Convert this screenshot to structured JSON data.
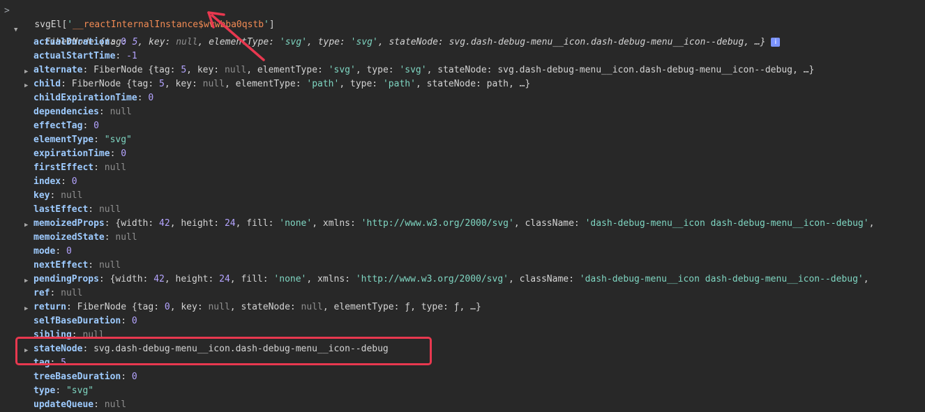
{
  "command": {
    "prompt": ">",
    "prefix": "svgEl[",
    "quote_open": "'",
    "prop_name": "__reactInternalInstance$wvwbba0qstb",
    "quote_close": "'",
    "suffix": "]"
  },
  "root": {
    "label": "FiberNode",
    "summary_1": " {tag: ",
    "tag": "5",
    "summary_2": ", key: ",
    "key": "null",
    "summary_3": ", elementType: ",
    "elementType": "'svg'",
    "summary_4": ", type: ",
    "type": "'svg'",
    "summary_5": ", stateNode: ",
    "stateNode": "svg.dash-debug-menu__icon.dash-debug-menu__icon--debug",
    "summary_6": ", …}"
  },
  "props": [
    {
      "key": "actualDuration",
      "sep": ": ",
      "value": "0",
      "kind": "num",
      "expandable": false
    },
    {
      "key": "actualStartTime",
      "sep": ": ",
      "value": "-1",
      "kind": "num",
      "expandable": false
    },
    {
      "key": "alternate",
      "sep": ": ",
      "value": "FiberNode {tag: 5, key: null, elementType: 'svg', type: 'svg', stateNode: svg.dash-debug-menu__icon.dash-debug-menu__icon--debug, …}",
      "kind": "obj",
      "expandable": true
    },
    {
      "key": "child",
      "sep": ": ",
      "value": "FiberNode {tag: 5, key: null, elementType: 'path', type: 'path', stateNode: path, …}",
      "kind": "obj",
      "expandable": true
    },
    {
      "key": "childExpirationTime",
      "sep": ": ",
      "value": "0",
      "kind": "num",
      "expandable": false
    },
    {
      "key": "dependencies",
      "sep": ": ",
      "value": "null",
      "kind": "nul",
      "expandable": false
    },
    {
      "key": "effectTag",
      "sep": ": ",
      "value": "0",
      "kind": "num",
      "expandable": false
    },
    {
      "key": "elementType",
      "sep": ": ",
      "value": "\"svg\"",
      "kind": "str",
      "expandable": false
    },
    {
      "key": "expirationTime",
      "sep": ": ",
      "value": "0",
      "kind": "num",
      "expandable": false
    },
    {
      "key": "firstEffect",
      "sep": ": ",
      "value": "null",
      "kind": "nul",
      "expandable": false
    },
    {
      "key": "index",
      "sep": ": ",
      "value": "0",
      "kind": "num",
      "expandable": false
    },
    {
      "key": "key",
      "sep": ": ",
      "value": "null",
      "kind": "nul",
      "expandable": false
    },
    {
      "key": "lastEffect",
      "sep": ": ",
      "value": "null",
      "kind": "nul",
      "expandable": false
    },
    {
      "key": "memoizedProps",
      "sep": ": ",
      "value": "{width: 42, height: 24, fill: 'none', xmlns: 'http://www.w3.org/2000/svg', className: 'dash-debug-menu__icon dash-debug-menu__icon--debug',",
      "kind": "obj",
      "expandable": true
    },
    {
      "key": "memoizedState",
      "sep": ": ",
      "value": "null",
      "kind": "nul",
      "expandable": false
    },
    {
      "key": "mode",
      "sep": ": ",
      "value": "0",
      "kind": "num",
      "expandable": false
    },
    {
      "key": "nextEffect",
      "sep": ": ",
      "value": "null",
      "kind": "nul",
      "expandable": false
    },
    {
      "key": "pendingProps",
      "sep": ": ",
      "value": "{width: 42, height: 24, fill: 'none', xmlns: 'http://www.w3.org/2000/svg', className: 'dash-debug-menu__icon dash-debug-menu__icon--debug',",
      "kind": "obj",
      "expandable": true
    },
    {
      "key": "ref",
      "sep": ": ",
      "value": "null",
      "kind": "nul",
      "expandable": false
    },
    {
      "key": "return",
      "sep": ": ",
      "value": "FiberNode {tag: 0, key: null, stateNode: null, elementType: ƒ, type: ƒ, …}",
      "kind": "obj",
      "expandable": true
    },
    {
      "key": "selfBaseDuration",
      "sep": ": ",
      "value": "0",
      "kind": "num",
      "expandable": false
    },
    {
      "key": "sibling",
      "sep": ": ",
      "value": "null",
      "kind": "nul",
      "expandable": false
    },
    {
      "key": "stateNode",
      "sep": ": ",
      "value": "svg.dash-debug-menu__icon.dash-debug-menu__icon--debug",
      "kind": "obj",
      "expandable": true
    },
    {
      "key": "tag",
      "sep": ": ",
      "value": "5",
      "kind": "num",
      "expandable": false
    },
    {
      "key": "treeBaseDuration",
      "sep": ": ",
      "value": "0",
      "kind": "num",
      "expandable": false
    },
    {
      "key": "type",
      "sep": ": ",
      "value": "\"svg\"",
      "kind": "str",
      "expandable": false
    },
    {
      "key": "updateQueue",
      "sep": ": ",
      "value": "null",
      "kind": "nul",
      "expandable": false
    }
  ],
  "colors": {
    "background": "#282828",
    "annotation": "#e8384f",
    "key": "#9ecbff",
    "string": "#7fd6c2",
    "number": "#b4a4ff"
  }
}
